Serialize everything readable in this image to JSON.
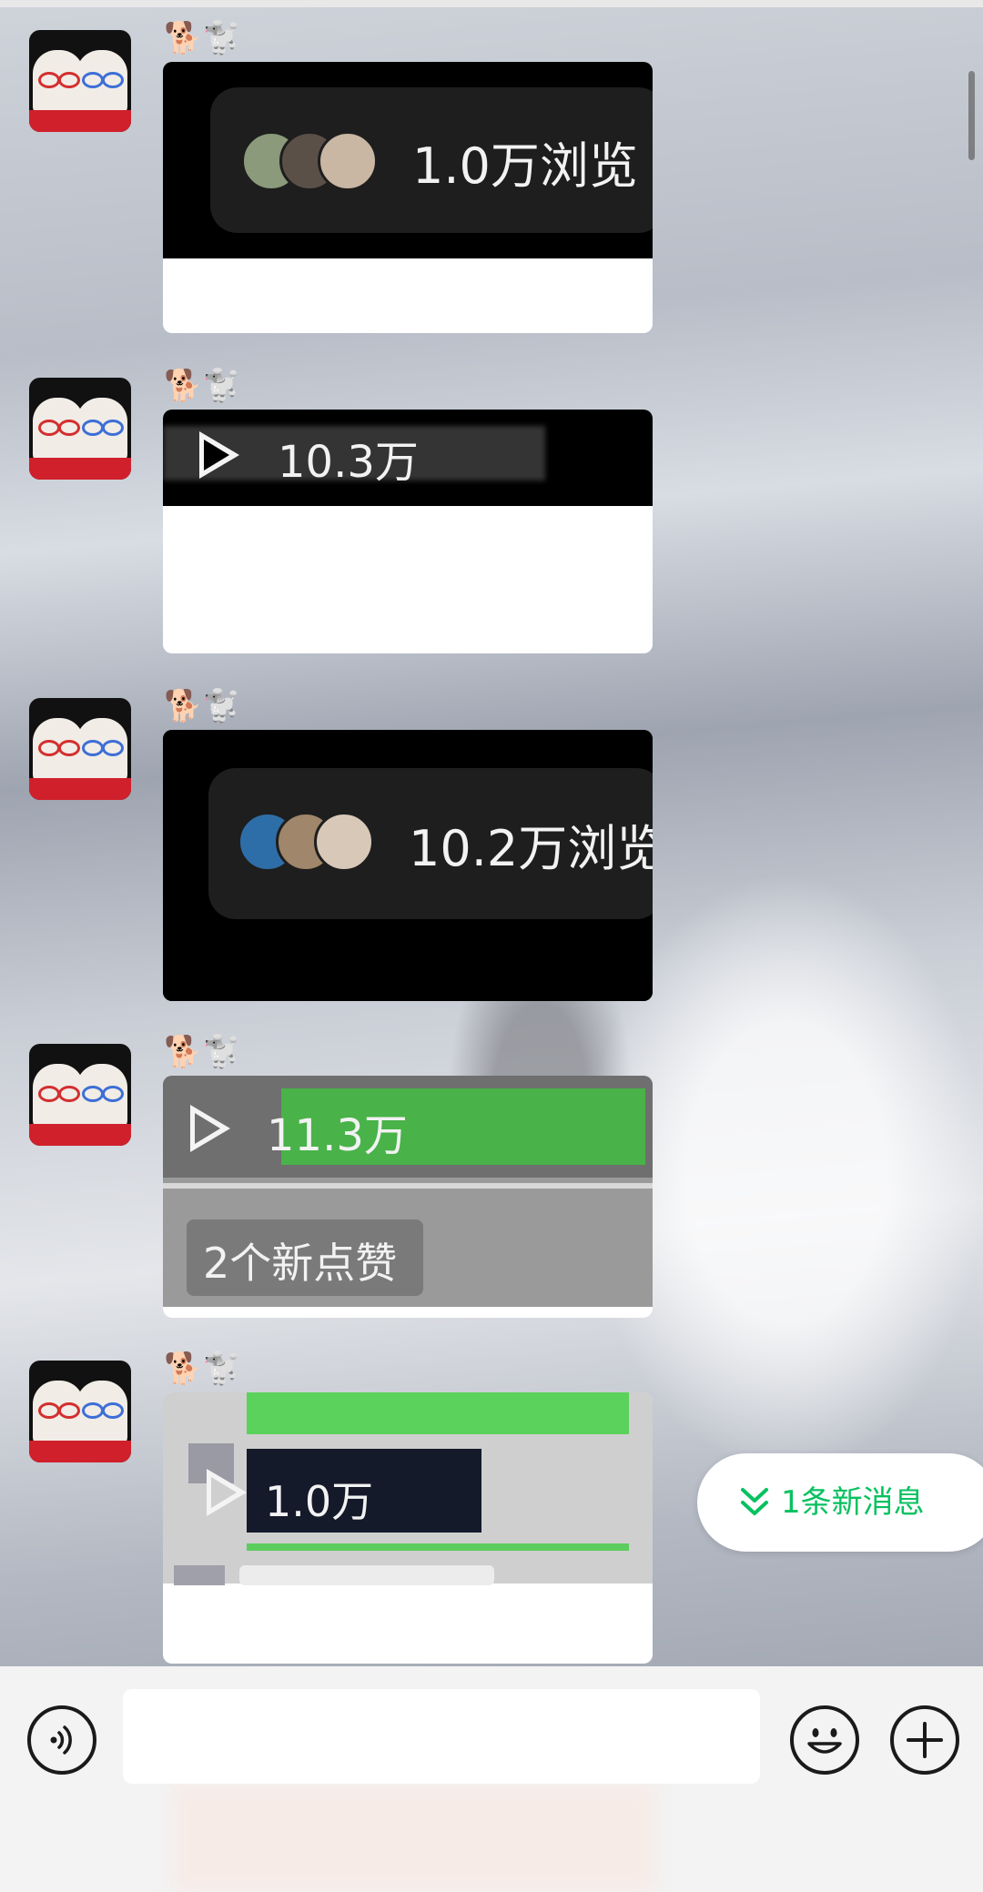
{
  "chat": {
    "sender_nickname": "🐕🐩",
    "messages": [
      {
        "kind": "views",
        "views_text": "1.0万浏览"
      },
      {
        "kind": "video",
        "plays_text": "10.3万"
      },
      {
        "kind": "views",
        "views_text": "10.2万浏览"
      },
      {
        "kind": "video",
        "plays_text": "11.3万",
        "likes_text": "2个新点赞"
      },
      {
        "kind": "video",
        "plays_text": "1.0万"
      }
    ]
  },
  "new_message_button": {
    "label": "1条新消息",
    "icon": "double-chevron-down-icon",
    "color": "#07c160"
  },
  "input_bar": {
    "message_value": "",
    "icons": [
      "voice-icon",
      "emoji-icon",
      "plus-icon"
    ]
  }
}
